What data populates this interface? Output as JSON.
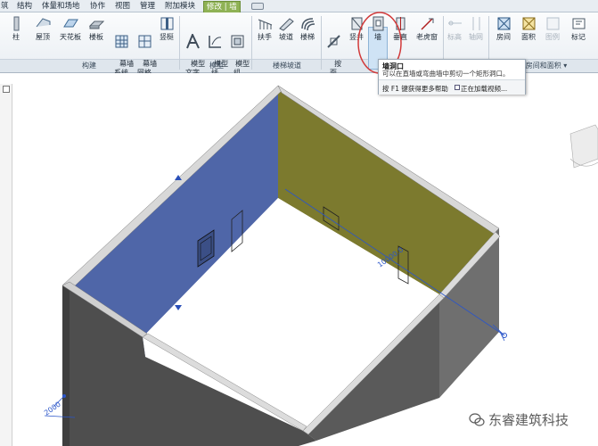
{
  "menu": {
    "tabs": [
      {
        "label": "筑"
      },
      {
        "label": "结构"
      },
      {
        "label": "体量和场地"
      },
      {
        "label": "协作"
      },
      {
        "label": "视图"
      },
      {
        "label": "管理"
      },
      {
        "label": "附加模块"
      },
      {
        "label": "修改 | 墙"
      }
    ]
  },
  "ribbon": {
    "tools": {
      "column": "柱",
      "roof": "屋顶",
      "ceiling": "天花板",
      "floor": "楼板",
      "curtain_system": "幕墙\n系统",
      "curtain_grid": "幕墙\n网格",
      "mullion": "竖梃",
      "model_text": "模型\n文字",
      "model_line": "模型\n线",
      "model_group": "模型\n组",
      "railing": "扶手",
      "ramp": "坡道",
      "stair": "楼梯",
      "by_face": "按\n面",
      "shaft": "竖井",
      "wall_opening": "墙",
      "vertical": "垂直",
      "dormer": "老虎窗",
      "level": "标高",
      "grid": "轴网",
      "room": "房间",
      "area": "面积",
      "tag": "图例",
      "label": "标记"
    },
    "panels": {
      "build": "构建",
      "model": "模型",
      "circulation": "楼梯坡道",
      "room_area": "房间和面积 ▾"
    }
  },
  "tooltip": {
    "title": "墙洞口",
    "description": "可以在直墙或弯曲墙中剪切一个矩形洞口。",
    "help": "按 F1 键获得更多帮助",
    "loading": "正在加载视频..."
  },
  "drawing": {
    "dimension_left": "2000",
    "dimension_right": "10000.0"
  },
  "colors": {
    "blue_wall": "#4f66a8",
    "olive_wall": "#7c7a2e",
    "gray_wall": "#6f6f6f",
    "dark_wall": "#4e4e4e",
    "wall_top": "#d9d9d9",
    "menu_active": "#8fb255",
    "highlight_circle": "#d23a3a"
  },
  "watermark": {
    "text": "东睿建筑科技",
    "icon": "wechat-icon"
  }
}
